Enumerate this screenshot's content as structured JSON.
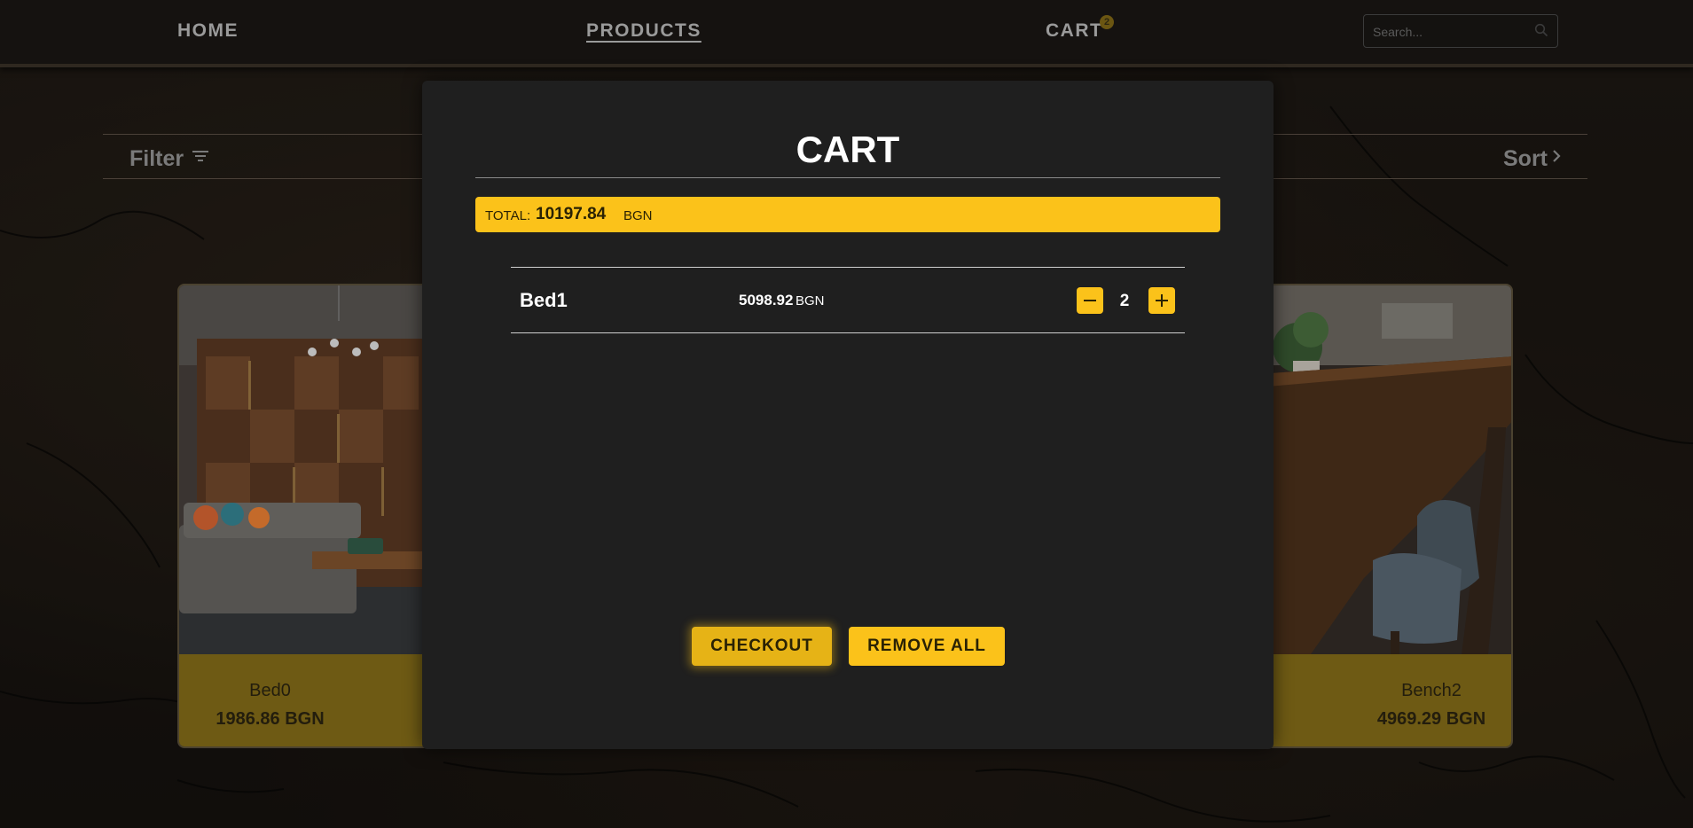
{
  "nav": {
    "home_label": "HOME",
    "products_label": "PRODUCTS",
    "cart_label": "CART",
    "cart_count": "2",
    "search_placeholder": "Search..."
  },
  "toolbar": {
    "filter_label": "Filter",
    "sort_label": "Sort"
  },
  "products": [
    {
      "name": "Bed0",
      "price": "1986.86 BGN"
    },
    {
      "name": "Bench2",
      "price": "4969.29 BGN"
    }
  ],
  "cart": {
    "title": "CART",
    "total_label": "TOTAL:",
    "total_value": "10197.84",
    "total_currency": "BGN",
    "items": [
      {
        "name": "Bed1",
        "price": "5098.92",
        "currency": "BGN",
        "quantity": "2"
      }
    ],
    "checkout_label": "CHECKOUT",
    "remove_all_label": "REMOVE ALL"
  },
  "colors": {
    "accent": "#fbc21a",
    "modal_bg": "#1f1f1f"
  },
  "icons": [
    "search-icon",
    "filter-icon",
    "chevron-right-icon",
    "minus-icon",
    "plus-icon"
  ]
}
